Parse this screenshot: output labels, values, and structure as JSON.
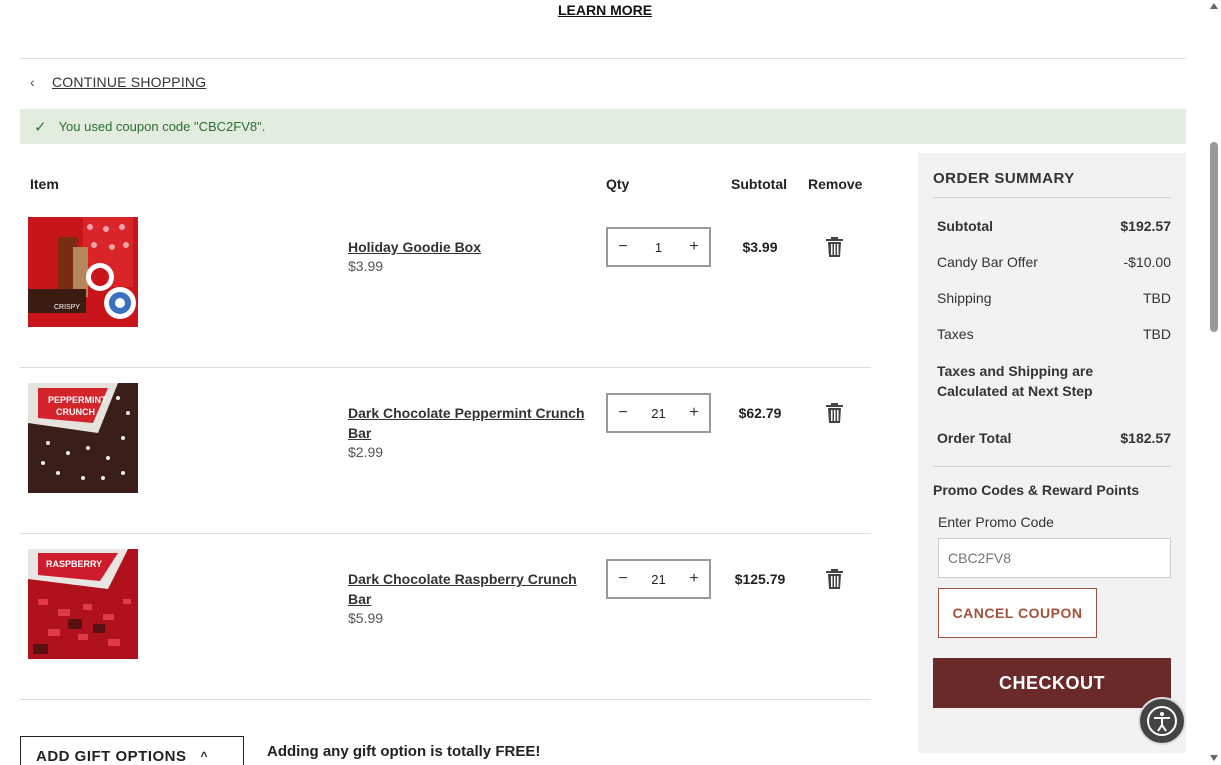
{
  "top": {
    "learn_more": "LEARN MORE"
  },
  "nav": {
    "continue_shopping": "CONTINUE SHOPPING"
  },
  "coupon_banner": {
    "message": "You used coupon code \"CBC2FV8\"."
  },
  "cart": {
    "headers": {
      "item": "Item",
      "qty": "Qty",
      "subtotal": "Subtotal",
      "remove": "Remove"
    },
    "items": [
      {
        "name": "Holiday Goodie Box",
        "price": "$3.99",
        "qty": "1",
        "subtotal": "$3.99"
      },
      {
        "name": "Dark Chocolate Peppermint Crunch Bar",
        "price": "$2.99",
        "qty": "21",
        "subtotal": "$62.79"
      },
      {
        "name": "Dark Chocolate Raspberry Crunch Bar",
        "price": "$5.99",
        "qty": "21",
        "subtotal": "$125.79"
      }
    ]
  },
  "gift": {
    "button_label": "ADD GIFT OPTIONS",
    "note": "Adding any gift option is totally FREE!"
  },
  "summary": {
    "title": "ORDER SUMMARY",
    "subtotal_label": "Subtotal",
    "subtotal_value": "$192.57",
    "offer_label": "Candy Bar Offer",
    "offer_value": "-$10.00",
    "shipping_label": "Shipping",
    "shipping_value": "TBD",
    "taxes_label": "Taxes",
    "taxes_value": "TBD",
    "tax_note": "Taxes and Shipping are Calculated at Next Step",
    "total_label": "Order Total",
    "total_value": "$182.57",
    "promo_title": "Promo Codes & Reward Points",
    "promo_label": "Enter Promo Code",
    "promo_placeholder": "CBC2FV8",
    "cancel_coupon": "CANCEL COUPON",
    "checkout": "CHECKOUT"
  },
  "colors": {
    "accent": "#6b2a2a",
    "banner_bg": "#e2ede0",
    "banner_text": "#2b6f2b",
    "coupon_border": "#a0523a"
  },
  "icons": [
    "chevron-left-icon",
    "check-icon",
    "minus-icon",
    "plus-icon",
    "trash-icon",
    "chevron-up-icon",
    "accessibility-icon"
  ]
}
